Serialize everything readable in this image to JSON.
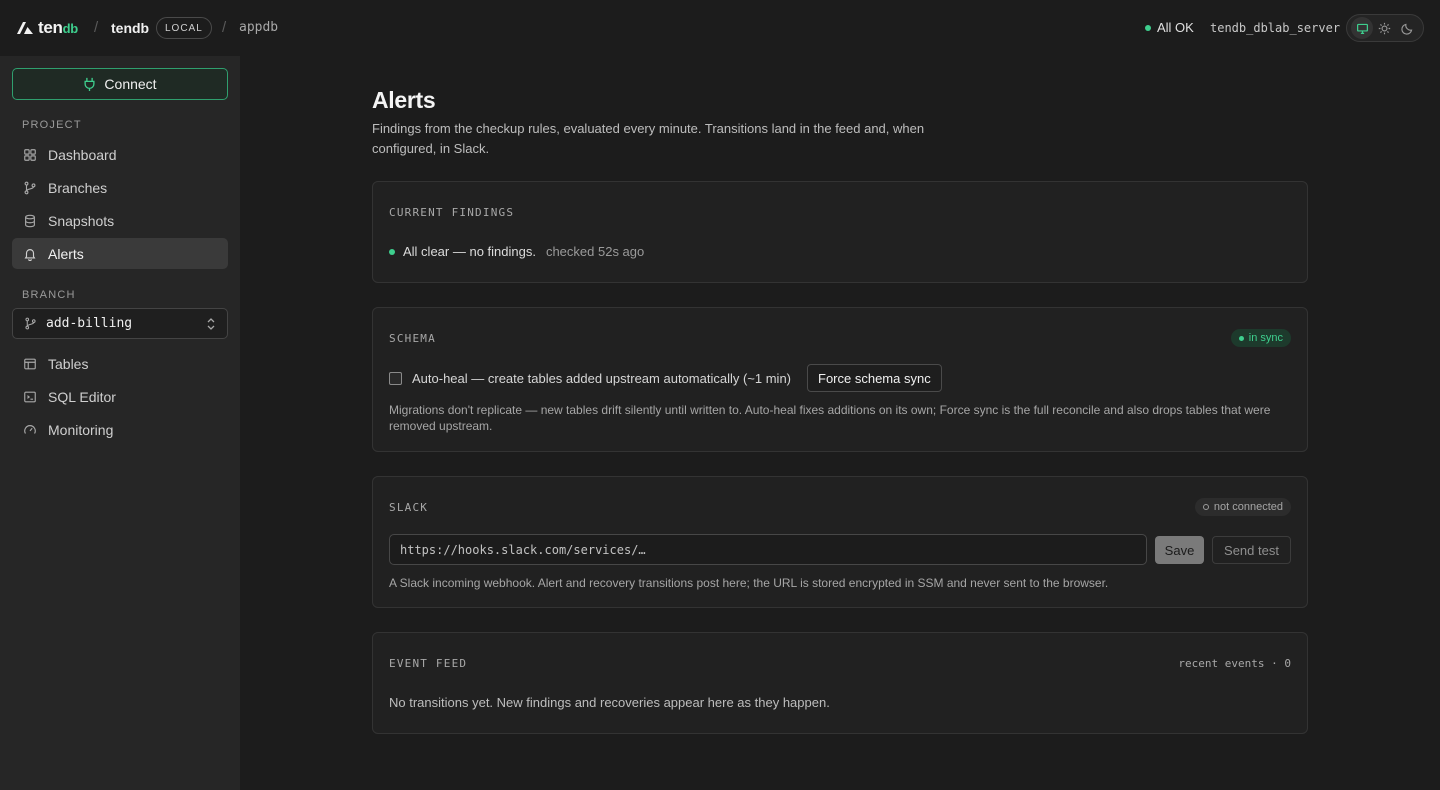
{
  "header": {
    "logo_main": "ten",
    "logo_suffix": "db",
    "project": "tendb",
    "env_badge": "LOCAL",
    "database": "appdb",
    "status": "All OK",
    "status_color": "#3ecf8e",
    "server": "tendb_dblab_server",
    "theme_options": [
      "monitor-icon",
      "sun-icon",
      "moon-icon"
    ],
    "theme_active": "monitor-icon"
  },
  "sidebar": {
    "connect_label": "Connect",
    "project_heading": "PROJECT",
    "project_items": [
      {
        "label": "Dashboard",
        "icon": "grid-icon"
      },
      {
        "label": "Branches",
        "icon": "git-branch-icon"
      },
      {
        "label": "Snapshots",
        "icon": "database-icon"
      },
      {
        "label": "Alerts",
        "icon": "bell-icon",
        "active": true
      }
    ],
    "branch_heading": "BRANCH",
    "branch_value": "add-billing",
    "branch_items": [
      {
        "label": "Tables",
        "icon": "table-icon"
      },
      {
        "label": "SQL Editor",
        "icon": "terminal-icon"
      },
      {
        "label": "Monitoring",
        "icon": "gauge-icon"
      }
    ]
  },
  "main": {
    "title": "Alerts",
    "description": "Findings from the checkup rules, evaluated every minute. Transitions land in the feed and, when configured, in Slack.",
    "findings": {
      "label": "CURRENT FINDINGS",
      "status": "All clear — no findings.",
      "checked": "checked 52s ago"
    },
    "schema": {
      "label": "SCHEMA",
      "badge": "in sync",
      "autoheal_label": "Auto-heal — create tables added upstream automatically (~1 min)",
      "autoheal_checked": false,
      "force_sync_label": "Force schema sync",
      "help": "Migrations don't replicate — new tables drift silently until written to. Auto-heal fixes additions on its own; Force sync is the full reconcile and also drops tables that were removed upstream."
    },
    "slack": {
      "label": "SLACK",
      "badge": "not connected",
      "webhook_placeholder": "https://hooks.slack.com/services/…",
      "save_label": "Save",
      "test_label": "Send test",
      "help": "A Slack incoming webhook. Alert and recovery transitions post here; the URL is stored encrypted in SSM and never sent to the browser."
    },
    "feed": {
      "label": "EVENT FEED",
      "meta": "recent events · 0",
      "empty": "No transitions yet. New findings and recoveries appear here as they happen."
    }
  }
}
